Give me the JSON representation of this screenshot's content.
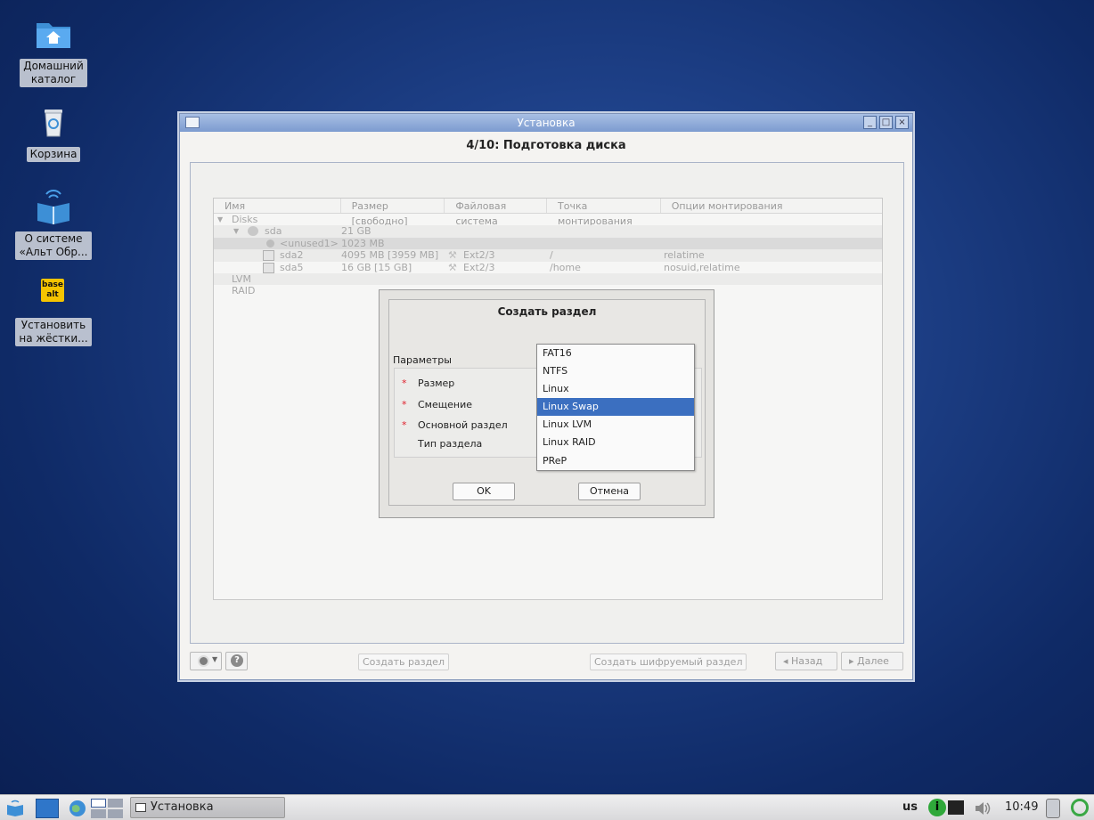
{
  "desktop": {
    "icons": [
      {
        "label_line1": "Домашний",
        "label_line2": "каталог",
        "icon": "home-folder-icon"
      },
      {
        "label_line1": "Корзина",
        "label_line2": "",
        "icon": "trash-icon"
      },
      {
        "label_line1": "О системе",
        "label_line2": "«Альт Обр...",
        "icon": "book-icon"
      },
      {
        "label_line1": "Установить",
        "label_line2": "на жёстки...",
        "icon": "installer-icon"
      }
    ],
    "installer_logo_text": "base alt"
  },
  "window": {
    "title": "Установка",
    "step_title": "4/10: Подготовка диска",
    "controls": {
      "minimize": "_",
      "maximize": "□",
      "close": "×"
    }
  },
  "tree": {
    "columns": [
      "Имя",
      "Размер [свободно]",
      "Файловая система",
      "Точка монтирования",
      "Опции монтирования"
    ],
    "rows": [
      {
        "name": "Disks",
        "size": "",
        "fs": "",
        "mount": "",
        "options": ""
      },
      {
        "name": "sda",
        "size": "21 GB",
        "fs": "",
        "mount": "",
        "options": ""
      },
      {
        "name": "<unused1>",
        "size": "1023 MB",
        "fs": "",
        "mount": "",
        "options": ""
      },
      {
        "name": "sda2",
        "size": "4095 MB [3959 MB]",
        "fs": "Ext2/3",
        "mount": "/",
        "options": "relatime"
      },
      {
        "name": "sda5",
        "size": "16 GB [15 GB]",
        "fs": "Ext2/3",
        "mount": "/home",
        "options": "nosuid,relatime"
      },
      {
        "name": "LVM",
        "size": "",
        "fs": "",
        "mount": "",
        "options": ""
      },
      {
        "name": "RAID",
        "size": "",
        "fs": "",
        "mount": "",
        "options": ""
      }
    ]
  },
  "actions": {
    "create_partition": "Создать раздел",
    "create_encrypted": "Создать шифруемый раздел"
  },
  "nav": {
    "back": "◂ Назад",
    "next": "▸ Далее",
    "help": "?"
  },
  "dialog": {
    "title": "Создать раздел",
    "params_label": "Параметры",
    "fields": [
      {
        "label": "Размер",
        "required": true
      },
      {
        "label": "Смещение",
        "required": true
      },
      {
        "label": "Основной раздел",
        "required": true
      },
      {
        "label": "Тип раздела",
        "required": false
      }
    ],
    "required_mark": "*",
    "ok": "OK",
    "cancel": "Отмена",
    "dropdown": {
      "options": [
        "FAT16",
        "NTFS",
        "Linux",
        "Linux Swap",
        "Linux LVM",
        "Linux RAID",
        "PReP"
      ],
      "selected": "Linux Swap"
    }
  },
  "taskbar": {
    "task_label": "Установка",
    "keyboard_layout": "us",
    "clock": "10:49"
  },
  "colors": {
    "selection": "#3b6fc0",
    "required_star": "#e0202c",
    "titlebar": "#7c9bd0"
  }
}
